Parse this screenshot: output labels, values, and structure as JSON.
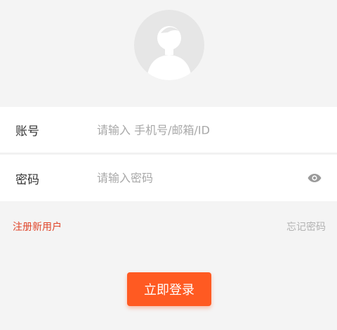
{
  "login_form": {
    "account": {
      "label": "账号",
      "value": "",
      "placeholder": "请输入 手机号/邮箱/ID"
    },
    "password": {
      "label": "密码",
      "value": "",
      "placeholder": "请输入密码",
      "visibility_icon": "eye-icon"
    }
  },
  "links": {
    "register": "注册新用户",
    "forgot_password": "忘记密码"
  },
  "actions": {
    "login_label": "立即登录"
  },
  "avatar": {
    "icon": "user-silhouette-icon"
  },
  "colors": {
    "accent": "#ff5a22",
    "register_link": "#e0452a",
    "muted_link": "#b2b2b2",
    "background": "#f4f4f4"
  }
}
